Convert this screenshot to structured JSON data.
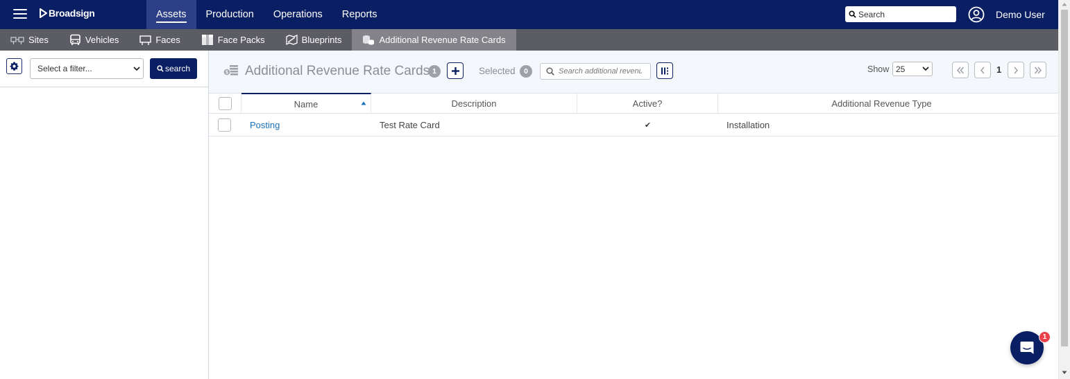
{
  "brand": {
    "name": "Broadsign"
  },
  "topnav": {
    "items": [
      {
        "label": "Assets",
        "active": true
      },
      {
        "label": "Production",
        "active": false
      },
      {
        "label": "Operations",
        "active": false
      },
      {
        "label": "Reports",
        "active": false
      }
    ],
    "search_placeholder": "Search",
    "user_name": "Demo User"
  },
  "subnav": {
    "items": [
      {
        "label": "Sites",
        "icon": "sites-icon"
      },
      {
        "label": "Vehicles",
        "icon": "bus-icon"
      },
      {
        "label": "Faces",
        "icon": "billboard-icon"
      },
      {
        "label": "Face Packs",
        "icon": "package-icon"
      },
      {
        "label": "Blueprints",
        "icon": "blueprint-icon"
      },
      {
        "label": "Additional Revenue Rate Cards",
        "icon": "coins-icon",
        "active": true
      }
    ]
  },
  "filter_panel": {
    "select_placeholder": "Select a filter...",
    "search_label": "search"
  },
  "main": {
    "title": "Additional Revenue Rate Cards",
    "count": "1",
    "selected_label": "Selected",
    "selected_count": "0",
    "search_placeholder": "Search additional revenue rate cards",
    "show_label": "Show",
    "page_size": "25",
    "current_page": "1"
  },
  "table": {
    "columns": [
      "Name",
      "Description",
      "Active?",
      "Additional Revenue Type"
    ],
    "sort": {
      "column": "Name",
      "direction": "ascending"
    },
    "rows": [
      {
        "name": "Posting",
        "description": "Test Rate Card",
        "active": "✔",
        "type": "Installation"
      }
    ]
  },
  "chat": {
    "unread": "1"
  },
  "colors": {
    "navy": "#0a1f63",
    "subnav": "#5c5c64",
    "subnav_active": "#838389",
    "link": "#1a6fb5",
    "badge_red": "#e9424a"
  }
}
